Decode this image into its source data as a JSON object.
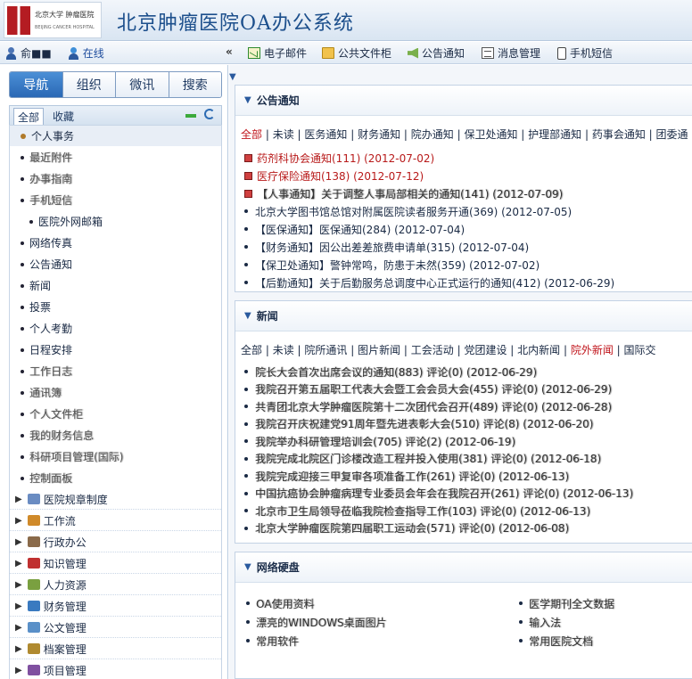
{
  "brand": {
    "logo_cn": "北京大学 肿瘤医院",
    "logo_en": "BEIJING CANCER HOSPITAL",
    "title": "北京肿瘤医院OA办公系统"
  },
  "user": {
    "name": "俞■■",
    "status": "在线"
  },
  "toolbar": {
    "collapse": "«",
    "items": [
      {
        "label": "电子邮件",
        "icon": "mail-icon"
      },
      {
        "label": "公共文件柜",
        "icon": "folder-icon"
      },
      {
        "label": "公告通知",
        "icon": "speaker-icon"
      },
      {
        "label": "消息管理",
        "icon": "message-icon"
      },
      {
        "label": "手机短信",
        "icon": "phone-icon"
      }
    ]
  },
  "sidebar": {
    "tabs": [
      "导航",
      "组织",
      "微讯",
      "搜索"
    ],
    "active_tab": "导航",
    "sub_tabs": [
      "全部",
      "收藏"
    ],
    "items": [
      {
        "label": "个人事务",
        "kind": "head"
      },
      {
        "label": "最近附件",
        "kind": "blur"
      },
      {
        "label": "办事指南",
        "kind": "blur"
      },
      {
        "label": "手机短信",
        "kind": "blur"
      },
      {
        "label": "医院外网邮箱",
        "kind": "sub"
      },
      {
        "label": "网络传真",
        "kind": "plain"
      },
      {
        "label": "公告通知",
        "kind": "plain"
      },
      {
        "label": "新闻",
        "kind": "plain"
      },
      {
        "label": "投票",
        "kind": "plain"
      },
      {
        "label": "个人考勤",
        "kind": "plain"
      },
      {
        "label": "日程安排",
        "kind": "plain"
      },
      {
        "label": "工作日志",
        "kind": "blur"
      },
      {
        "label": "通讯簿",
        "kind": "blur"
      },
      {
        "label": "个人文件柜",
        "kind": "blur"
      },
      {
        "label": "我的财务信息",
        "kind": "blur"
      },
      {
        "label": "科研项目管理(国际)",
        "kind": "blur"
      },
      {
        "label": "控制面板",
        "kind": "blur"
      },
      {
        "label": "医院规章制度",
        "kind": "group"
      },
      {
        "label": "工作流",
        "kind": "group"
      },
      {
        "label": "行政办公",
        "kind": "group"
      },
      {
        "label": "知识管理",
        "kind": "group"
      },
      {
        "label": "人力资源",
        "kind": "group"
      },
      {
        "label": "财务管理",
        "kind": "group"
      },
      {
        "label": "公文管理",
        "kind": "group"
      },
      {
        "label": "档案管理",
        "kind": "group"
      },
      {
        "label": "项目管理",
        "kind": "group"
      }
    ]
  },
  "notices": {
    "title": "公告通知",
    "categories": [
      "全部",
      "未读",
      "医务通知",
      "财务通知",
      "院办通知",
      "保卫处通知",
      "护理部通知",
      "药事会通知",
      "团委通"
    ],
    "items": [
      {
        "text": "药剂科协会通知(111) (2012-07-02)",
        "kind": "red"
      },
      {
        "text": "医疗保险通知(138) (2012-07-12)",
        "kind": "red"
      },
      {
        "text": "【人事通知】关于调整人事局部相关的通知(141) (2012-07-09)",
        "kind": "blur"
      },
      {
        "text": "北京大学图书馆总馆对附属医院读者服务开通(369) (2012-07-05)",
        "kind": "plain"
      },
      {
        "text": "【医保通知】医保通知(284) (2012-07-04)",
        "kind": "plain"
      },
      {
        "text": "【财务通知】因公出差差旅费申请单(315) (2012-07-04)",
        "kind": "plain"
      },
      {
        "text": "【保卫处通知】警钟常鸣，防患于未然(359) (2012-07-02)",
        "kind": "plain"
      },
      {
        "text": "【后勤通知】关于后勤服务总调度中心正式运行的通知(412) (2012-06-29)",
        "kind": "plain"
      }
    ]
  },
  "news": {
    "title": "新闻",
    "categories": [
      "全部",
      "未读",
      "院所通讯",
      "图片新闻",
      "工会活动",
      "党团建设",
      "北内新闻",
      "院外新闻",
      "国际交"
    ],
    "items": [
      {
        "text": "院长大会首次出席会议的通知(883) 评论(0) (2012-06-29)"
      },
      {
        "text": "我院召开第五届职工代表大会暨工会会员大会(455) 评论(0) (2012-06-29)"
      },
      {
        "text": "共青团北京大学肿瘤医院第十二次团代会召开(489) 评论(0) (2012-06-28)"
      },
      {
        "text": "我院召开庆祝建党91周年暨先进表彰大会(510) 评论(8) (2012-06-20)"
      },
      {
        "text": "我院举办科研管理培训会(705) 评论(2) (2012-06-19)"
      },
      {
        "text": "我院完成北院区门诊楼改造工程并投入使用(381) 评论(0) (2012-06-18)"
      },
      {
        "text": "我院完成迎接三甲复审各项准备工作(261) 评论(0) (2012-06-13)"
      },
      {
        "text": "中国抗癌协会肿瘤病理专业委员会年会在我院召开(261) 评论(0) (2012-06-13)"
      },
      {
        "text": "北京市卫生局领导莅临我院检查指导工作(103) 评论(0) (2012-06-13)"
      },
      {
        "text": "北京大学肿瘤医院第四届职工运动会(571) 评论(0) (2012-06-08)"
      }
    ]
  },
  "network": {
    "title": "网络硬盘",
    "items": [
      "OA使用资料",
      "漂亮的WINDOWS桌面图片",
      "常用软件",
      "医学期刊全文数据",
      "输入法",
      "常用医院文档"
    ]
  }
}
